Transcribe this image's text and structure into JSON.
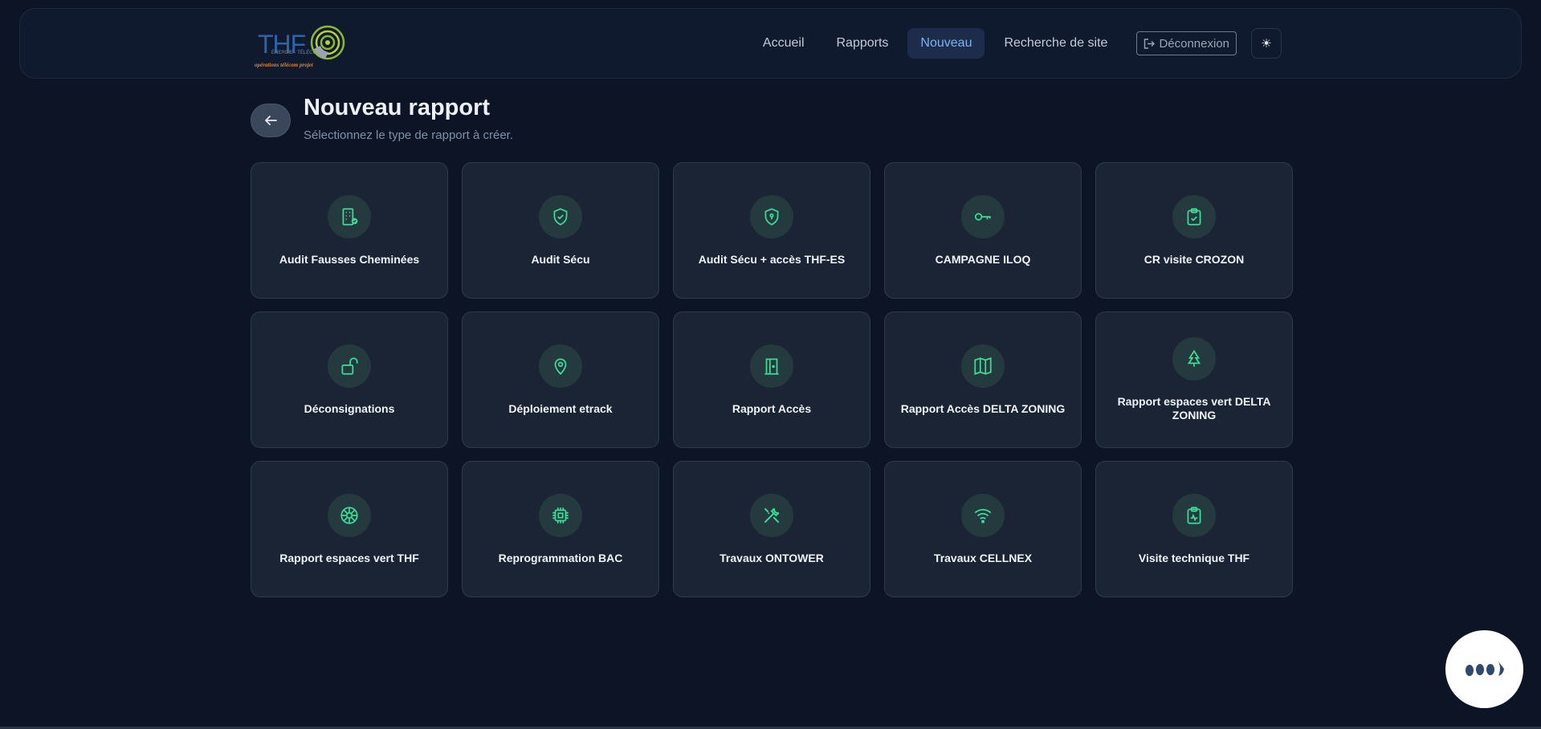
{
  "logo": {
    "text": "THF",
    "subtitle": "ÉNERGIE · TÉLÉCOM",
    "tagline": "opérations télécom projet"
  },
  "nav": {
    "items": [
      {
        "label": "Accueil"
      },
      {
        "label": "Rapports"
      },
      {
        "label": "Nouveau",
        "active": true
      },
      {
        "label": "Recherche de site"
      }
    ],
    "logout_label": "Déconnexion",
    "theme_icon": "sun-icon"
  },
  "page": {
    "title": "Nouveau rapport",
    "subtitle": "Sélectionnez le type de rapport à créer."
  },
  "cards": [
    {
      "label": "Audit Fausses Cheminées",
      "icon": "building-check-icon"
    },
    {
      "label": "Audit Sécu",
      "icon": "shield-check-icon"
    },
    {
      "label": "Audit Sécu + accès THF-ES",
      "icon": "shield-keyhole-icon"
    },
    {
      "label": "CAMPAGNE ILOQ",
      "icon": "key-icon"
    },
    {
      "label": "CR visite CROZON",
      "icon": "clipboard-check-icon"
    },
    {
      "label": "Déconsignations",
      "icon": "lock-open-icon"
    },
    {
      "label": "Déploiement etrack",
      "icon": "map-pin-icon"
    },
    {
      "label": "Rapport Accès",
      "icon": "door-icon"
    },
    {
      "label": "Rapport Accès DELTA ZONING",
      "icon": "map-icon"
    },
    {
      "label": "Rapport espaces vert DELTA ZONING",
      "icon": "tree-icon"
    },
    {
      "label": "Rapport espaces vert THF",
      "icon": "aperture-icon"
    },
    {
      "label": "Reprogrammation BAC",
      "icon": "cpu-icon"
    },
    {
      "label": "Travaux ONTOWER",
      "icon": "tools-icon"
    },
    {
      "label": "Travaux CELLNEX",
      "icon": "wifi-icon"
    },
    {
      "label": "Visite technique THF",
      "icon": "clipboard-pulse-icon"
    }
  ],
  "colors": {
    "accent": "#3ddc97",
    "active_nav": "#7ab3f4",
    "background": "#0c1426",
    "card": "#1a2435"
  }
}
